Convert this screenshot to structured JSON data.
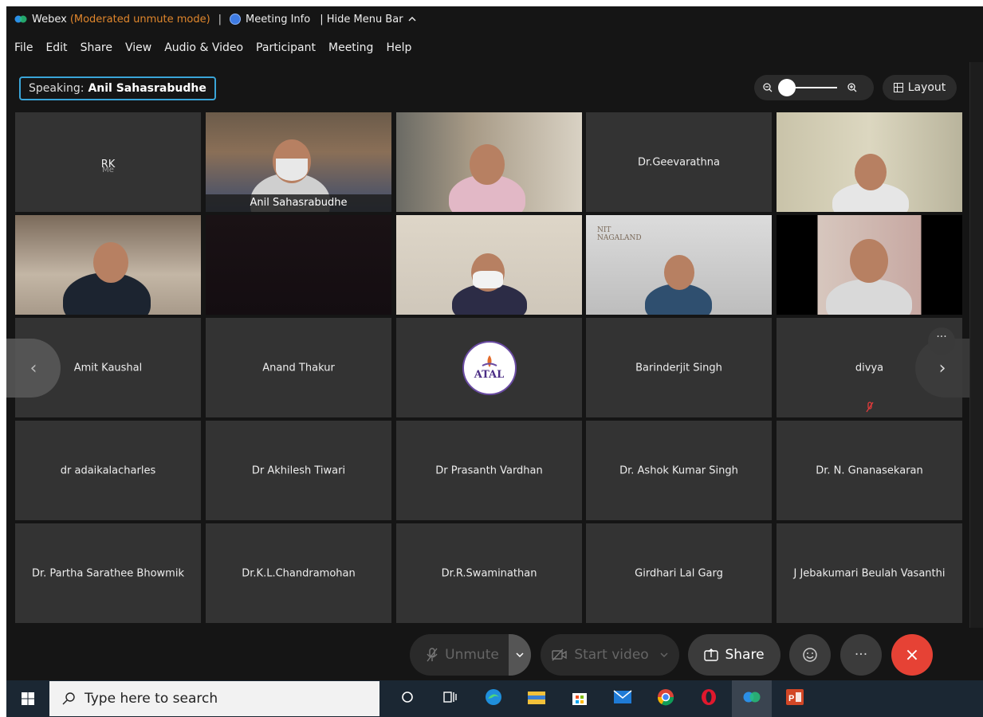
{
  "titlebar": {
    "app": "Webex",
    "mode": "(Moderated unmute mode)",
    "sep": "|",
    "meeting_info": "Meeting Info",
    "hide_menu": "| Hide Menu Bar",
    "hide_menu_icon": "chevron-up-icon"
  },
  "menu": [
    "File",
    "Edit",
    "Share",
    "View",
    "Audio & Video",
    "Participant",
    "Meeting",
    "Help"
  ],
  "speaking": {
    "label": "Speaking:",
    "name": "Anil Sahasrabudhe"
  },
  "layout": {
    "label": "Layout"
  },
  "tiles": [
    {
      "name": "RK",
      "sub": "Me",
      "video": false
    },
    {
      "name": "Anil Sahasrabudhe",
      "video": true,
      "caption": true,
      "active": true
    },
    {
      "name": "",
      "video": true
    },
    {
      "name": "Dr.Geevarathna",
      "video": false
    },
    {
      "name": "",
      "video": true
    },
    {
      "name": "",
      "video": true
    },
    {
      "name": "",
      "video": true,
      "dark": true
    },
    {
      "name": "",
      "video": true
    },
    {
      "name": "",
      "video": true
    },
    {
      "name": "",
      "video": true
    },
    {
      "name": "Amit Kaushal",
      "video": false
    },
    {
      "name": "Anand Thakur",
      "video": false
    },
    {
      "name": "",
      "video": false,
      "logo": "ATAL"
    },
    {
      "name": "Barinderjit Singh",
      "video": false
    },
    {
      "name": "divya",
      "video": false,
      "muted": true
    },
    {
      "name": "dr adaikalacharles",
      "video": false
    },
    {
      "name": "Dr Akhilesh Tiwari",
      "video": false
    },
    {
      "name": "Dr Prasanth Vardhan",
      "video": false
    },
    {
      "name": "Dr. Ashok Kumar Singh",
      "video": false
    },
    {
      "name": "Dr. N. Gnanasekaran",
      "video": false
    },
    {
      "name": "Dr. Partha Sarathee Bhowmik",
      "video": false
    },
    {
      "name": "Dr.K.L.Chandramohan",
      "video": false
    },
    {
      "name": "Dr.R.Swaminathan",
      "video": false
    },
    {
      "name": "Girdhari Lal Garg",
      "video": false
    },
    {
      "name": "J Jebakumari Beulah Vasanthi",
      "video": false
    }
  ],
  "controls": {
    "unmute": "Unmute",
    "start_video": "Start video",
    "share": "Share",
    "more": "···",
    "leave": "×"
  },
  "taskbar": {
    "search_placeholder": "Type here to search",
    "apps": [
      "cortana-icon",
      "task-view-icon",
      "edge-icon",
      "file-explorer-icon",
      "store-icon",
      "mail-icon",
      "chrome-icon",
      "opera-icon",
      "webex-icon",
      "powerpoint-icon"
    ]
  },
  "nav_left": "‹",
  "nav_right": "›",
  "tile_more": "···",
  "nitl_sign": "NIT NAGALAND",
  "colors": {
    "accent": "#2fa9e0",
    "leave": "#e64235",
    "mode": "#e0862c",
    "tile": "#333333",
    "bg": "#151515"
  }
}
